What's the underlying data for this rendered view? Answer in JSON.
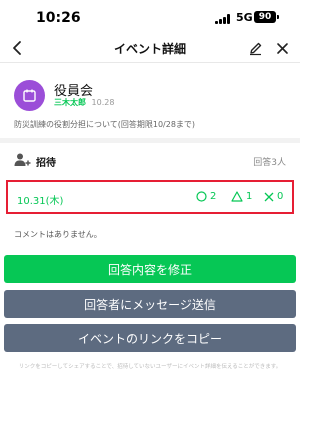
{
  "status_bar": {
    "time": "10:26",
    "network": "5G",
    "battery": "90"
  },
  "nav": {
    "title": "イベント詳細",
    "back_icon": "chevron-left-icon",
    "edit_icon": "pencil-icon",
    "close_icon": "close-icon"
  },
  "event": {
    "title": "役員会",
    "organizer": "三木太郎",
    "created_time": "10.28",
    "description": "防災訓練の役割分担について(回答期限10/28まで)",
    "avatar_icon": "calendar-icon",
    "avatar_color": "#9b4ed8"
  },
  "invite": {
    "label": "招待",
    "reply_count": "回答3人",
    "icon": "person-add-icon"
  },
  "date_option": {
    "date": "10.31(木)",
    "yes_count": "2",
    "maybe_count": "1",
    "no_count": "0"
  },
  "comment_text": "コメントはありません。",
  "buttons": {
    "edit_reply": "回答内容を修正",
    "message_responders": "回答者にメッセージ送信",
    "copy_link": "イベントのリンクをコピー"
  },
  "footer_note": "リンクをコピーしてシェアすることで、招待していないユーザーにイベント詳細を伝えることができます。",
  "colors": {
    "accent_green": "#06c755",
    "highlight_red": "#e61e34",
    "secondary_button": "#5d6b80"
  }
}
